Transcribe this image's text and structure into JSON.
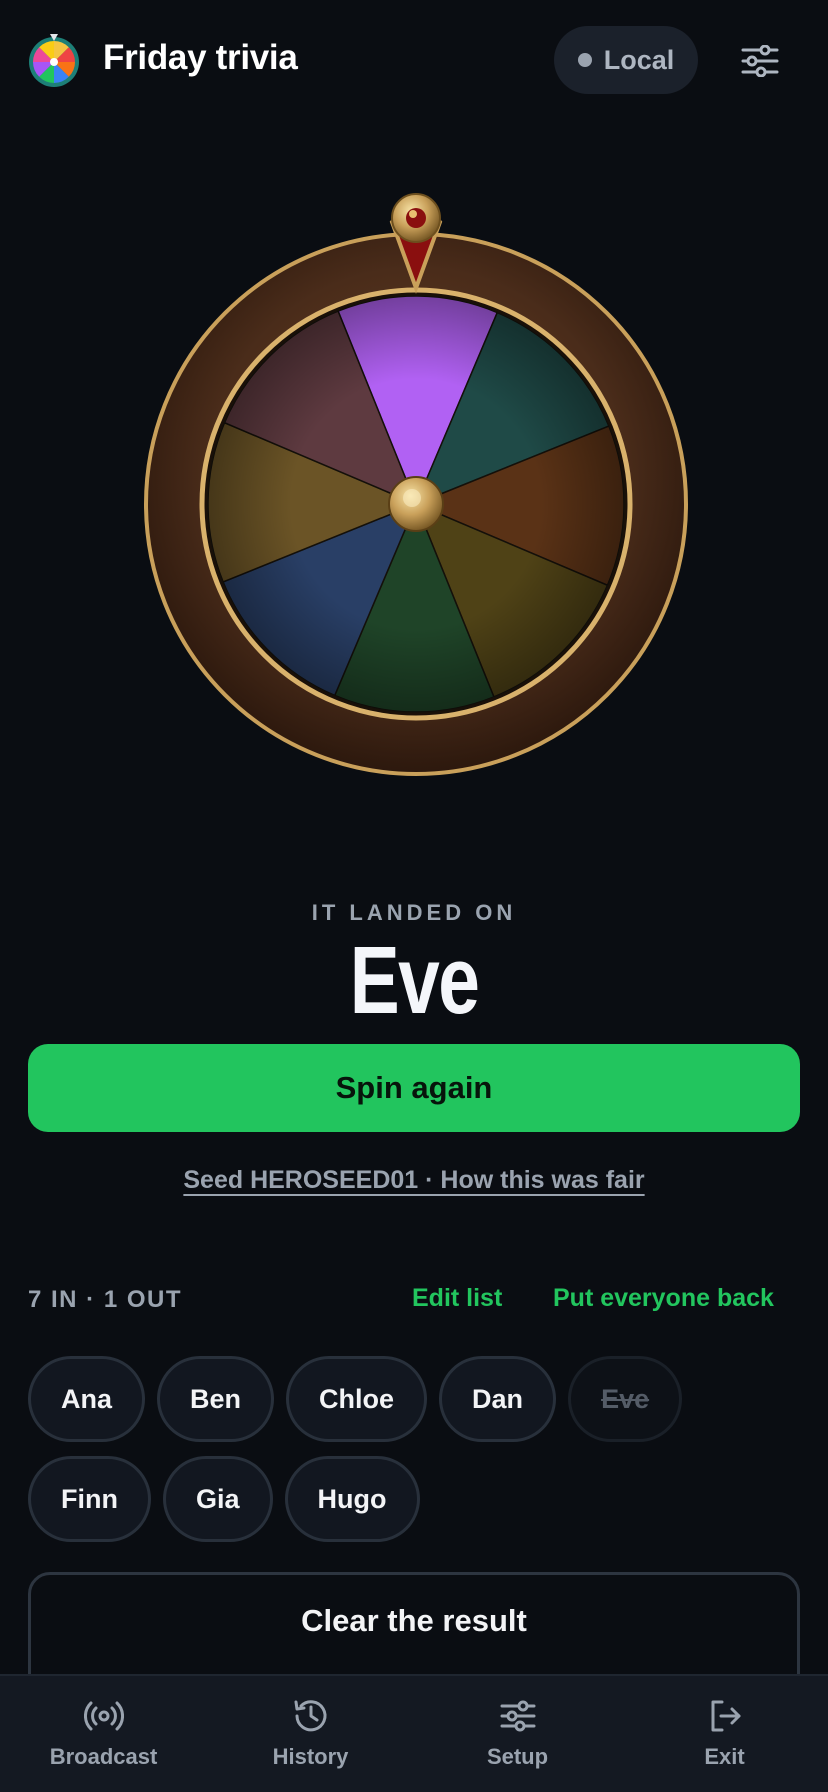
{
  "header": {
    "app_title": "Friday trivia",
    "mode_label": "Local",
    "logo_icon": "wheel-logo-icon",
    "settings_icon": "sliders-icon"
  },
  "wheel": {
    "segment_colors": [
      "#b161f3",
      "#1f4a47",
      "#5a3216",
      "#4f4216",
      "#1f4428",
      "#293f66",
      "#6b5426",
      "#5e3a40"
    ],
    "highlighted_segment": 0,
    "frame_color": "#4a2c1a",
    "rim_color": "#c9a05a",
    "pointer_color": "#8a0f0f"
  },
  "result": {
    "caption": "IT LANDED ON",
    "name": "Eve",
    "spin_label": "Spin again",
    "seed_text": "Seed HEROSEED01 · How this was fair"
  },
  "roster": {
    "count_text": "7 IN · 1 OUT",
    "edit_label": "Edit list",
    "reset_label": "Put everyone back",
    "people": [
      {
        "name": "Ana",
        "out": false
      },
      {
        "name": "Ben",
        "out": false
      },
      {
        "name": "Chloe",
        "out": false
      },
      {
        "name": "Dan",
        "out": false
      },
      {
        "name": "Eve",
        "out": true
      },
      {
        "name": "Finn",
        "out": false
      },
      {
        "name": "Gia",
        "out": false
      },
      {
        "name": "Hugo",
        "out": false
      }
    ]
  },
  "clear_label": "Clear the result",
  "nav": {
    "items": [
      {
        "label": "Broadcast",
        "icon": "broadcast-icon"
      },
      {
        "label": "History",
        "icon": "history-icon"
      },
      {
        "label": "Setup",
        "icon": "sliders-icon"
      },
      {
        "label": "Exit",
        "icon": "exit-icon"
      }
    ]
  },
  "colors": {
    "accent": "#22c55e",
    "background": "#0a0d12",
    "muted": "#9aa3af"
  }
}
